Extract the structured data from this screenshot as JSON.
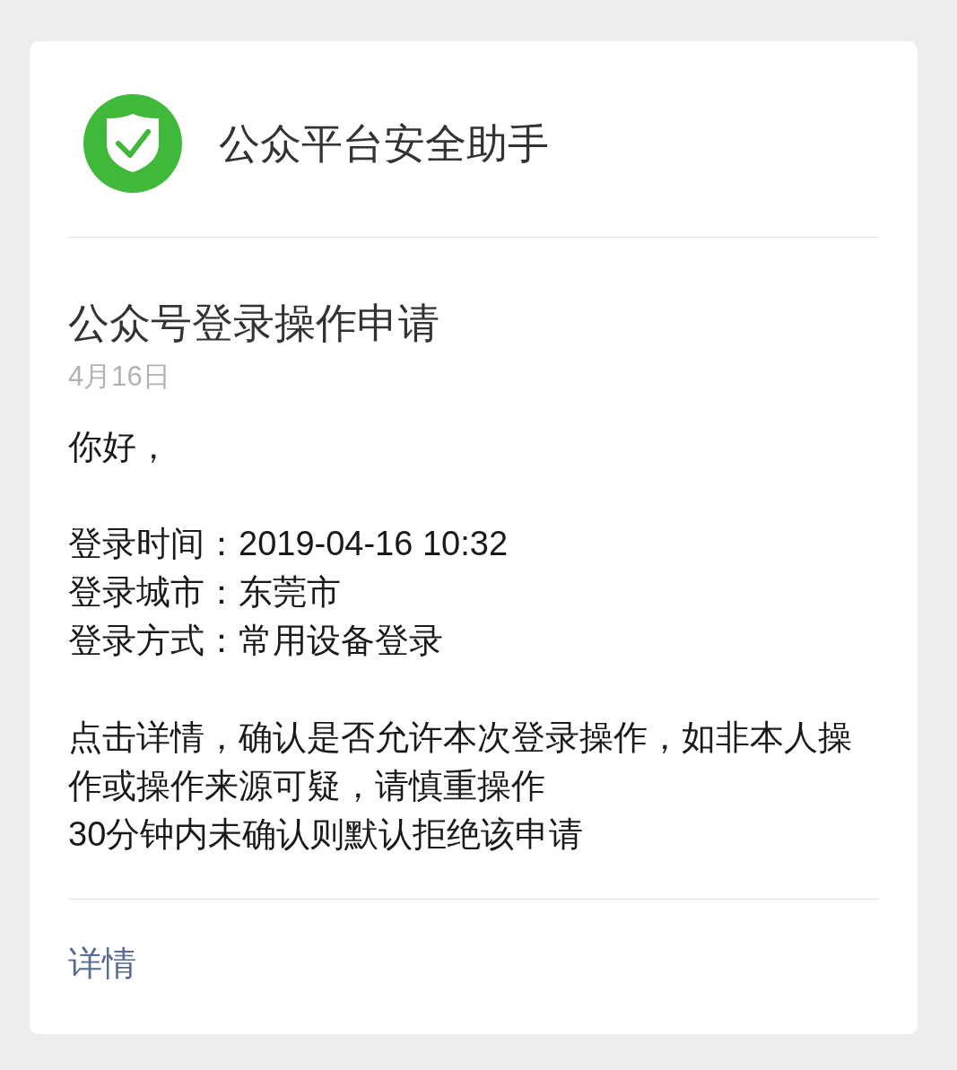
{
  "header": {
    "title": "公众平台安全助手"
  },
  "message": {
    "subject": "公众号登录操作申请",
    "date": "4月16日",
    "greeting": "你好，",
    "details": [
      "登录时间：2019-04-16 10:32",
      "登录城市：东莞市",
      "登录方式：常用设备登录"
    ],
    "notes": [
      "点击详情，确认是否允许本次登录操作，如非本人操作或操作来源可疑，请慎重操作",
      "30分钟内未确认则默认拒绝该申请"
    ]
  },
  "footer": {
    "link": "详情"
  }
}
